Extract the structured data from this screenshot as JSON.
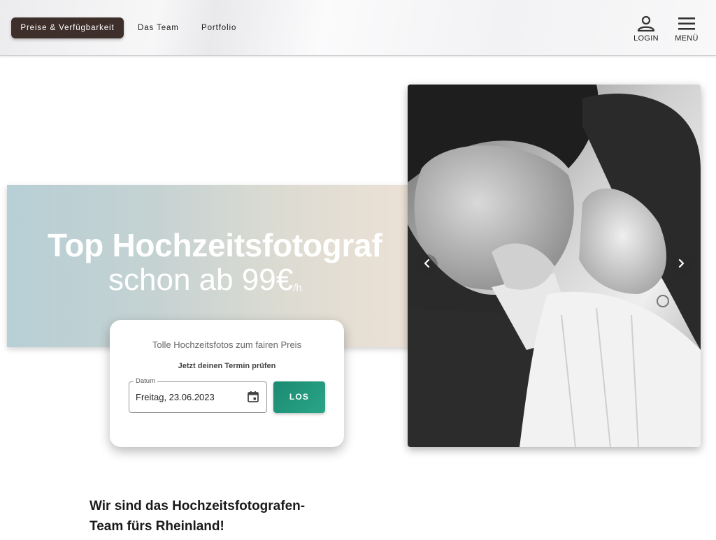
{
  "nav": {
    "primary_label": "Preise & Verfügbarkeit",
    "team_label": "Das Team",
    "portfolio_label": "Portfolio",
    "login_label": "LOGIN",
    "menu_label": "MENÜ"
  },
  "hero": {
    "title": "Top Hochzeitsfotograf",
    "subtitle": "schon ab 99€",
    "subtitle_unit": "/h"
  },
  "booking": {
    "tagline": "Tolle Hochzeitsfotos zum fairen Preis",
    "prompt": "Jetzt deinen Termin prüfen",
    "date_label": "Datum",
    "date_value": "Freitag, 23.06.2023",
    "submit_label": "LOS"
  },
  "intro": {
    "heading": "Wir sind das Hochzeitsfotografen-Team fürs Rheinland!"
  },
  "colors": {
    "nav_pill": "#3e2f2b",
    "accent": "#1f9279",
    "hero_left": "#b7cfd6",
    "hero_right": "#eee2d6"
  },
  "icons": {
    "login": "person-icon",
    "menu": "hamburger-icon",
    "date": "calendar-icon",
    "carousel_prev": "chevron-left-icon",
    "carousel_next": "chevron-right-icon"
  }
}
